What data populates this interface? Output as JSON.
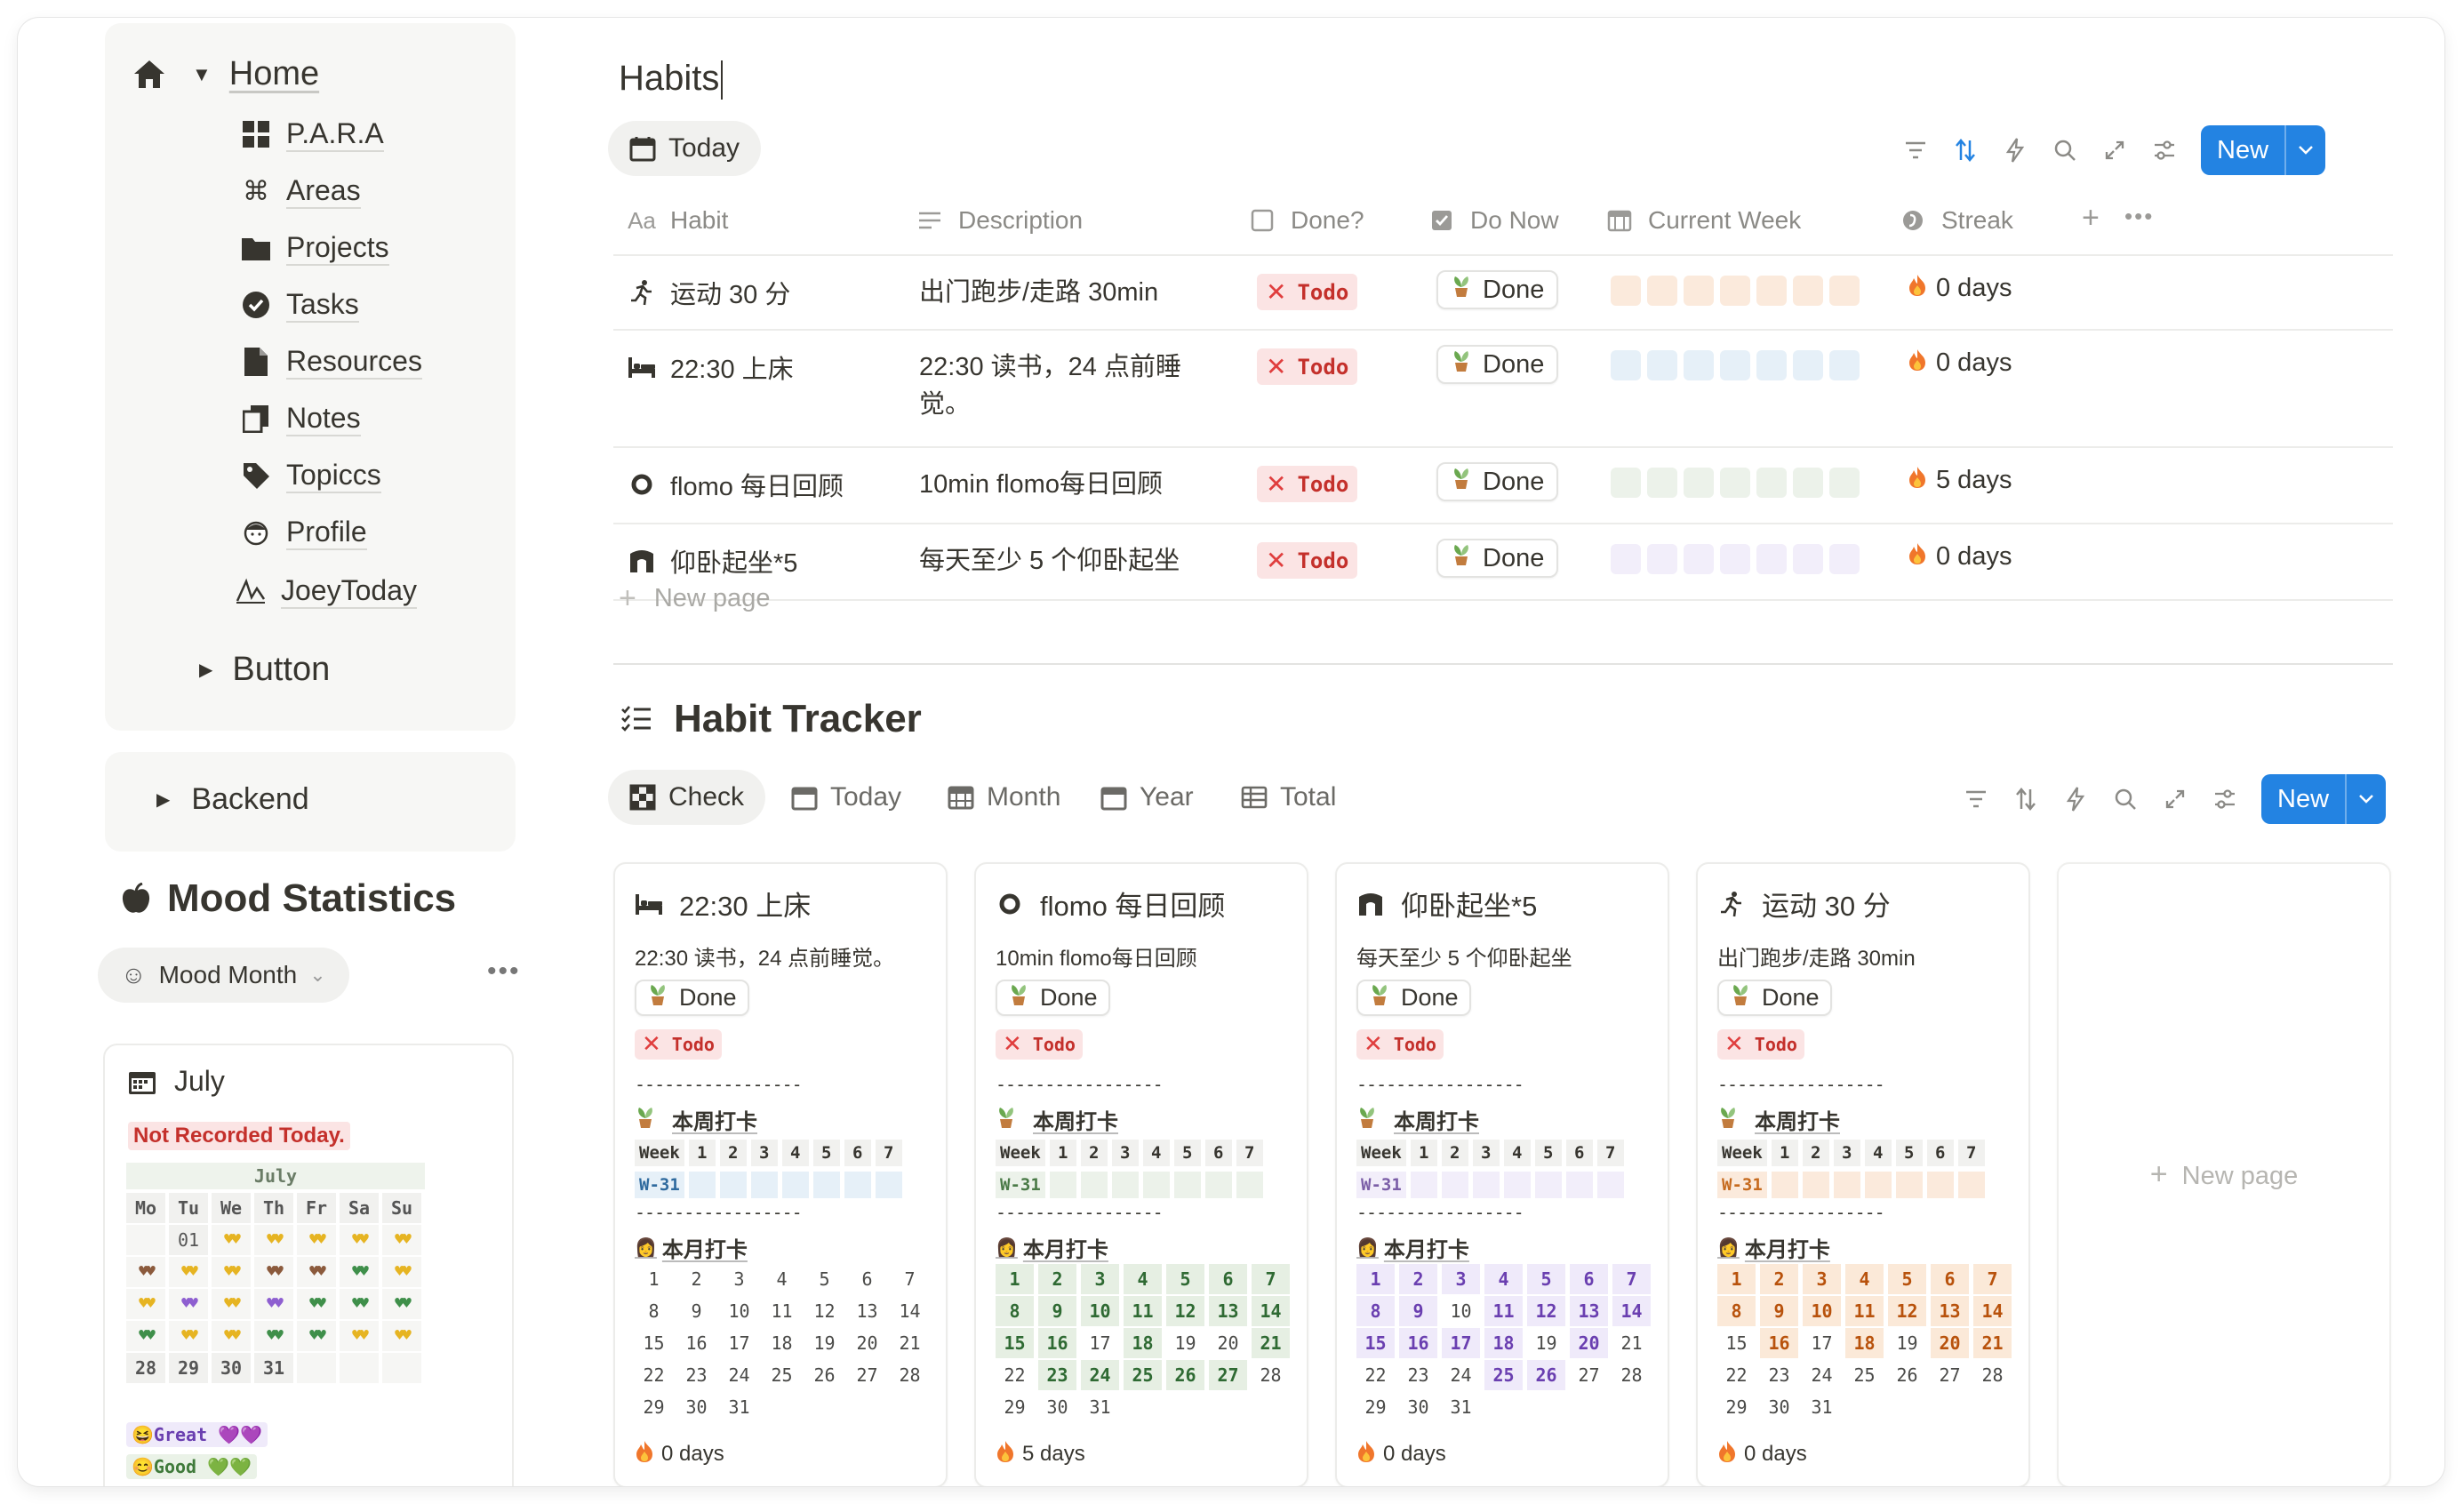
{
  "sidebar": {
    "home": "Home",
    "items": [
      {
        "label": "P.A.R.A",
        "icon": "grid-icon"
      },
      {
        "label": "Areas",
        "icon": "command-icon"
      },
      {
        "label": "Projects",
        "icon": "folder-icon"
      },
      {
        "label": "Tasks",
        "icon": "check-circle-icon"
      },
      {
        "label": "Resources",
        "icon": "document-icon"
      },
      {
        "label": "Notes",
        "icon": "notes-icon"
      },
      {
        "label": "Topiccs",
        "icon": "tag-icon"
      },
      {
        "label": "Profile",
        "icon": "avatar-icon"
      },
      {
        "label": "JoeyToday",
        "icon": "signature-icon"
      }
    ],
    "button": "Button",
    "backend": "Backend"
  },
  "mood": {
    "title": "Mood Statistics",
    "tab": "Mood Month",
    "month": "July",
    "not_recorded": "Not Recorded Today.",
    "cal_head": "July",
    "weekdays": [
      "Mo",
      "Tu",
      "We",
      "Th",
      "Fr",
      "Sa",
      "Su"
    ],
    "first_day": "01",
    "last_days": [
      "28",
      "29",
      "30",
      "31"
    ],
    "legend_great": "😆Great 💜💜",
    "legend_good": "😊Good 💚💚"
  },
  "habits": {
    "title": "Habits",
    "view": "Today",
    "new_label": "New",
    "columns": {
      "habit": "Habit",
      "description": "Description",
      "done": "Done?",
      "do_now": "Do Now",
      "current_week": "Current Week",
      "streak": "Streak"
    },
    "rows": [
      {
        "name": "运动 30 分",
        "desc": "出门跑步/走路 30min",
        "todo": "Todo",
        "done": "Done",
        "streak": "0 days",
        "week_color": "#fbeadc"
      },
      {
        "name": "22:30 上床",
        "desc": "22:30 读书，24 点前睡觉。",
        "todo": "Todo",
        "done": "Done",
        "streak": "0 days",
        "week_color": "#e6f0f8"
      },
      {
        "name": "flomo 每日回顾",
        "desc": "10min flomo每日回顾",
        "todo": "Todo",
        "done": "Done",
        "streak": "5 days",
        "week_color": "#ecf2ea"
      },
      {
        "name": "仰卧起坐*5",
        "desc": "每天至少 5 个仰卧起坐",
        "todo": "Todo",
        "done": "Done",
        "streak": "0 days",
        "week_color": "#f2eefa"
      }
    ],
    "new_page": "New page"
  },
  "tracker": {
    "title": "Habit Tracker",
    "tabs": [
      "Check",
      "Today",
      "Month",
      "Year",
      "Total"
    ],
    "new_label": "New",
    "new_page": "New page",
    "separator": "-----------------",
    "week_section": "本周打卡",
    "month_section": "本月打卡",
    "week_label": "Week",
    "week_nums": [
      "1",
      "2",
      "3",
      "4",
      "5",
      "6",
      "7"
    ],
    "cards": [
      {
        "name": "22:30 上床",
        "desc": "22:30 读书，24 点前睡觉。",
        "done": "Done",
        "todo": "Todo",
        "wtag": "W-31",
        "wcolor": "#2f6a9e",
        "wbg": "#e6f0f8",
        "streak": "0 days",
        "hl": [],
        "hlbg": "#e6f0f8",
        "hlfg": "#2f6a9e"
      },
      {
        "name": "flomo 每日回顾",
        "desc": "10min flomo每日回顾",
        "done": "Done",
        "todo": "Todo",
        "wtag": "W-31",
        "wcolor": "#4a7a47",
        "wbg": "#ecf2ea",
        "streak": "5 days",
        "hl": [
          1,
          2,
          3,
          4,
          5,
          6,
          7,
          8,
          9,
          10,
          11,
          12,
          13,
          14,
          15,
          16,
          18,
          21,
          23,
          24,
          25,
          26,
          27
        ],
        "hlbg": "#e6efe3",
        "hlfg": "#2f6a33"
      },
      {
        "name": "仰卧起坐*5",
        "desc": "每天至少 5 个仰卧起坐",
        "done": "Done",
        "todo": "Todo",
        "wtag": "W-31",
        "wcolor": "#7b5ea7",
        "wbg": "#f2eefa",
        "streak": "0 days",
        "hl": [
          1,
          2,
          3,
          4,
          5,
          6,
          7,
          8,
          9,
          11,
          12,
          13,
          14,
          15,
          16,
          17,
          18,
          20,
          25,
          26
        ],
        "hlbg": "#efeafa",
        "hlfg": "#6a3fb0"
      },
      {
        "name": "运动 30 分",
        "desc": "出门跑步/走路 30min",
        "done": "Done",
        "todo": "Todo",
        "wtag": "W-31",
        "wcolor": "#c66a1e",
        "wbg": "#fbeadc",
        "streak": "0 days",
        "hl": [
          1,
          2,
          3,
          4,
          5,
          6,
          7,
          8,
          9,
          10,
          11,
          12,
          13,
          14,
          16,
          18,
          20,
          21
        ],
        "hlbg": "#fbe9d8",
        "hlfg": "#b8520c"
      }
    ]
  },
  "colors": {
    "accent": "#2383e2",
    "todo_bg": "#fbe4e4",
    "todo_fg": "#c4302b"
  }
}
